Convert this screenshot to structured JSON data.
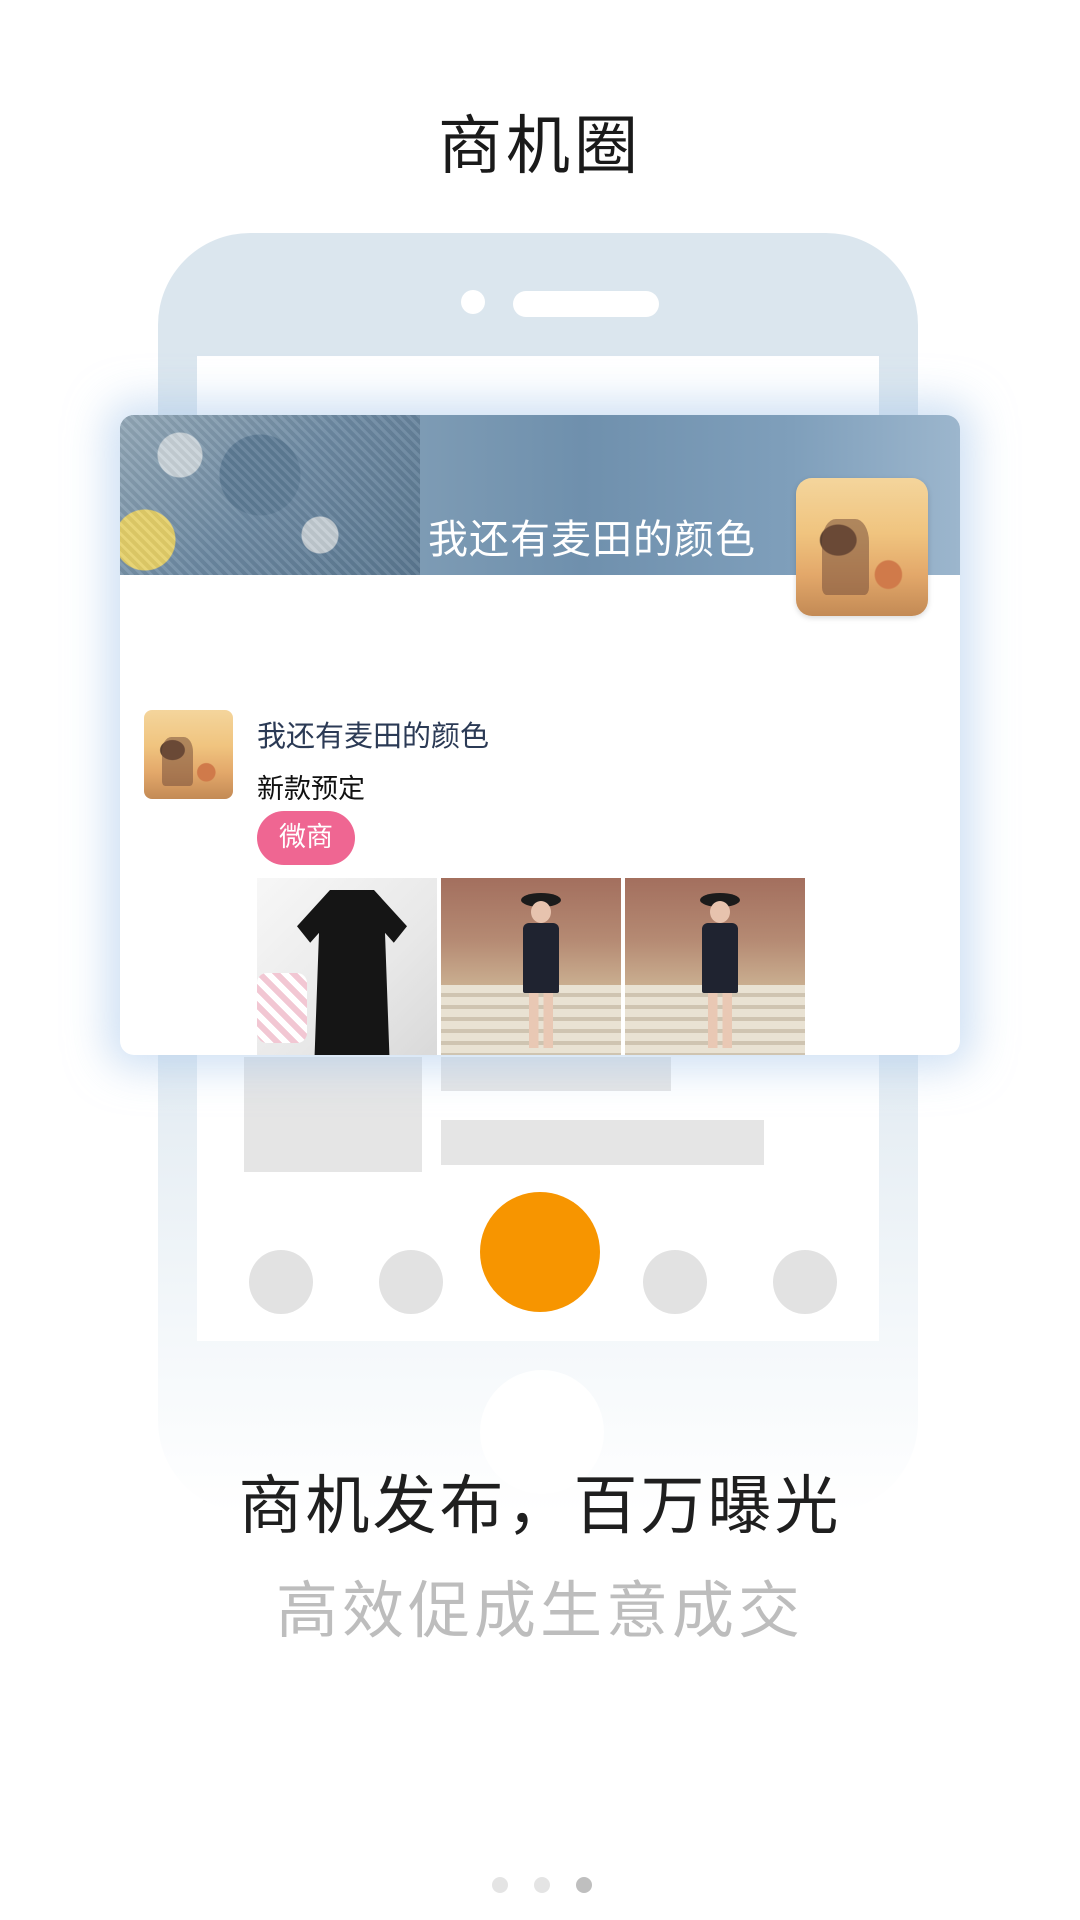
{
  "header": {
    "title": "商机圈"
  },
  "card": {
    "cover_title": "我还有麦田的颜色",
    "post": {
      "user_name": "我还有麦田的颜色",
      "text": "新款预定",
      "tag": "微商"
    }
  },
  "promo": {
    "headline": "商机发布，百万曝光",
    "subline": "高效促成生意成交"
  },
  "pager": {
    "total": 3,
    "current": 3
  },
  "colors": {
    "accent": "#f79500",
    "tag": "#ef6692",
    "phone_frame": "#dbe6ee"
  },
  "icons": [
    "avatar-image",
    "clothing-photo"
  ]
}
